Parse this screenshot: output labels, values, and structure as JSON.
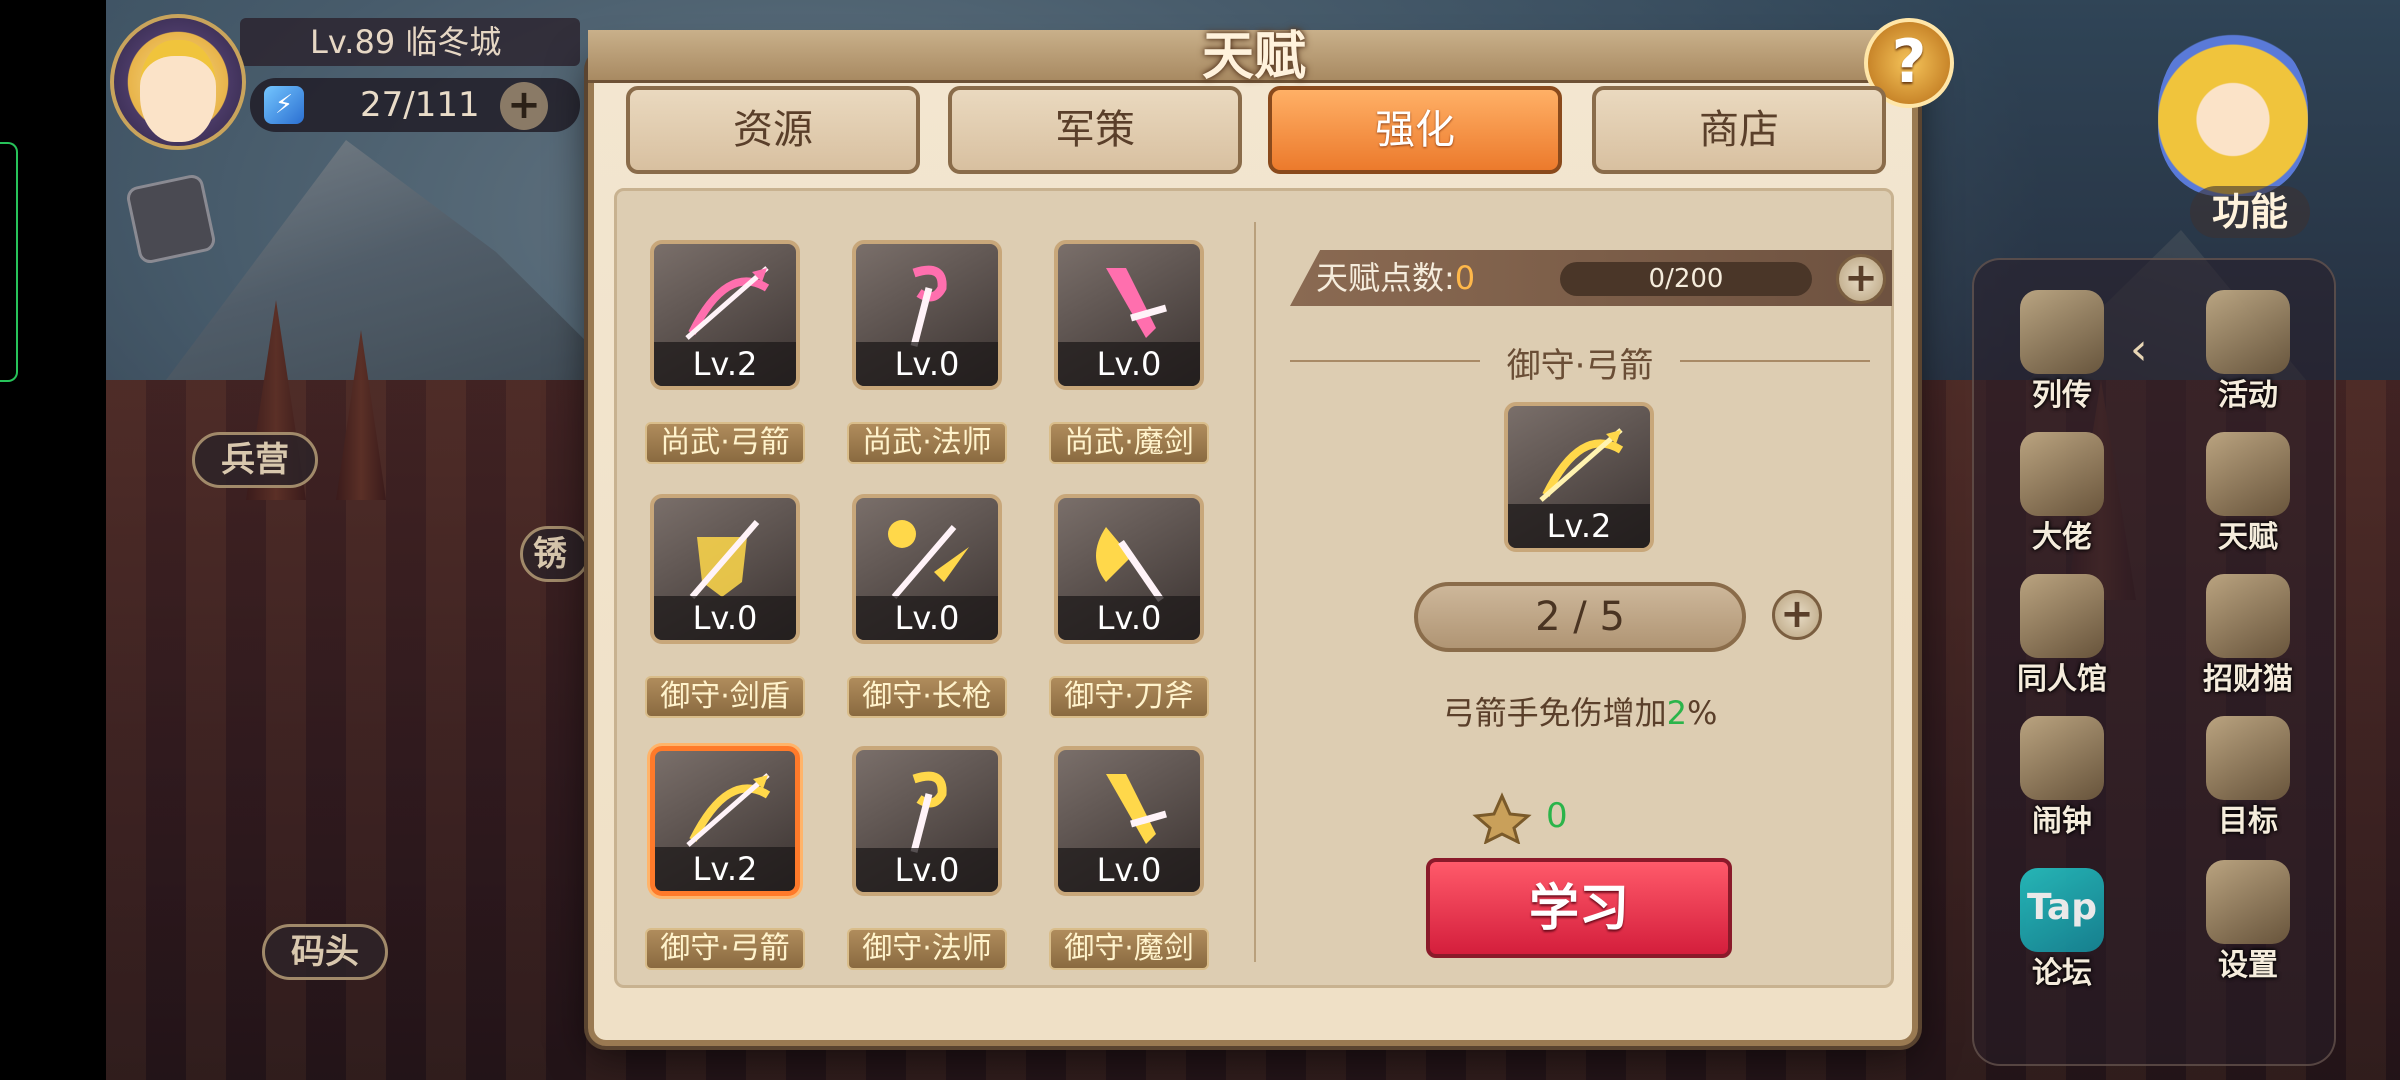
{
  "hud": {
    "level_text": "Lv.89  临冬城",
    "energy_text": "27/111",
    "energy_plus": "+"
  },
  "map_labels": [
    "兵营",
    "码头",
    "锈"
  ],
  "right_panel": {
    "func_label": "功能",
    "items": [
      {
        "label": "列传",
        "icon": "scroll-icon"
      },
      {
        "label": "活动",
        "icon": "star-medal-icon"
      },
      {
        "label": "大佬",
        "icon": "muscle-boss-icon"
      },
      {
        "label": "天赋",
        "icon": "talent-crest-icon"
      },
      {
        "label": "同人馆",
        "icon": "castle-icon"
      },
      {
        "label": "招财猫",
        "icon": "lucky-cat-icon"
      },
      {
        "label": "闹钟",
        "icon": "alarm-clock-icon"
      },
      {
        "label": "目标",
        "icon": "target-banner-icon"
      },
      {
        "label": "论坛",
        "icon": "taptap-icon",
        "icon_text": "Tap"
      },
      {
        "label": "设置",
        "icon": "gear-icon"
      }
    ]
  },
  "dialog": {
    "title": "天赋",
    "help": "?",
    "tabs": [
      {
        "label": "资源",
        "active": false
      },
      {
        "label": "军策",
        "active": false
      },
      {
        "label": "强化",
        "active": true
      },
      {
        "label": "商店",
        "active": false
      }
    ],
    "talents": [
      {
        "name": "尚武·弓箭",
        "level": "Lv.2",
        "icon": "bow-arrow-icon",
        "selected": false
      },
      {
        "name": "尚武·法师",
        "level": "Lv.0",
        "icon": "staff-icon",
        "selected": false
      },
      {
        "name": "尚武·魔剑",
        "level": "Lv.0",
        "icon": "sword-icon",
        "selected": false
      },
      {
        "name": "御守·剑盾",
        "level": "Lv.0",
        "icon": "sword-shield-icon",
        "selected": false
      },
      {
        "name": "御守·长枪",
        "level": "Lv.0",
        "icon": "spear-icon",
        "selected": false
      },
      {
        "name": "御守·刀斧",
        "level": "Lv.0",
        "icon": "axe-icon",
        "selected": false
      },
      {
        "name": "御守·弓箭",
        "level": "Lv.2",
        "icon": "bow-arrow-icon",
        "selected": true
      },
      {
        "name": "御守·法师",
        "level": "Lv.0",
        "icon": "staff-icon",
        "selected": false
      },
      {
        "name": "御守·魔剑",
        "level": "Lv.0",
        "icon": "sword-icon",
        "selected": false
      }
    ],
    "points": {
      "label": "天赋点数:",
      "value": "0",
      "bar_text": "0/200",
      "plus": "+"
    },
    "detail": {
      "title": "御守·弓箭",
      "level": "Lv.2",
      "progress_text": "2 / 5",
      "plus": "+",
      "effect_prefix": "弓箭手免伤增加",
      "effect_value": "2",
      "effect_suffix": "%",
      "cost": "0",
      "learn_label": "学习"
    }
  },
  "colors": {
    "active_tab": "#ec7a2c",
    "learn_button": "#d41e3c",
    "highlight_green": "#2bb44a",
    "points_value": "#ffb84a"
  }
}
